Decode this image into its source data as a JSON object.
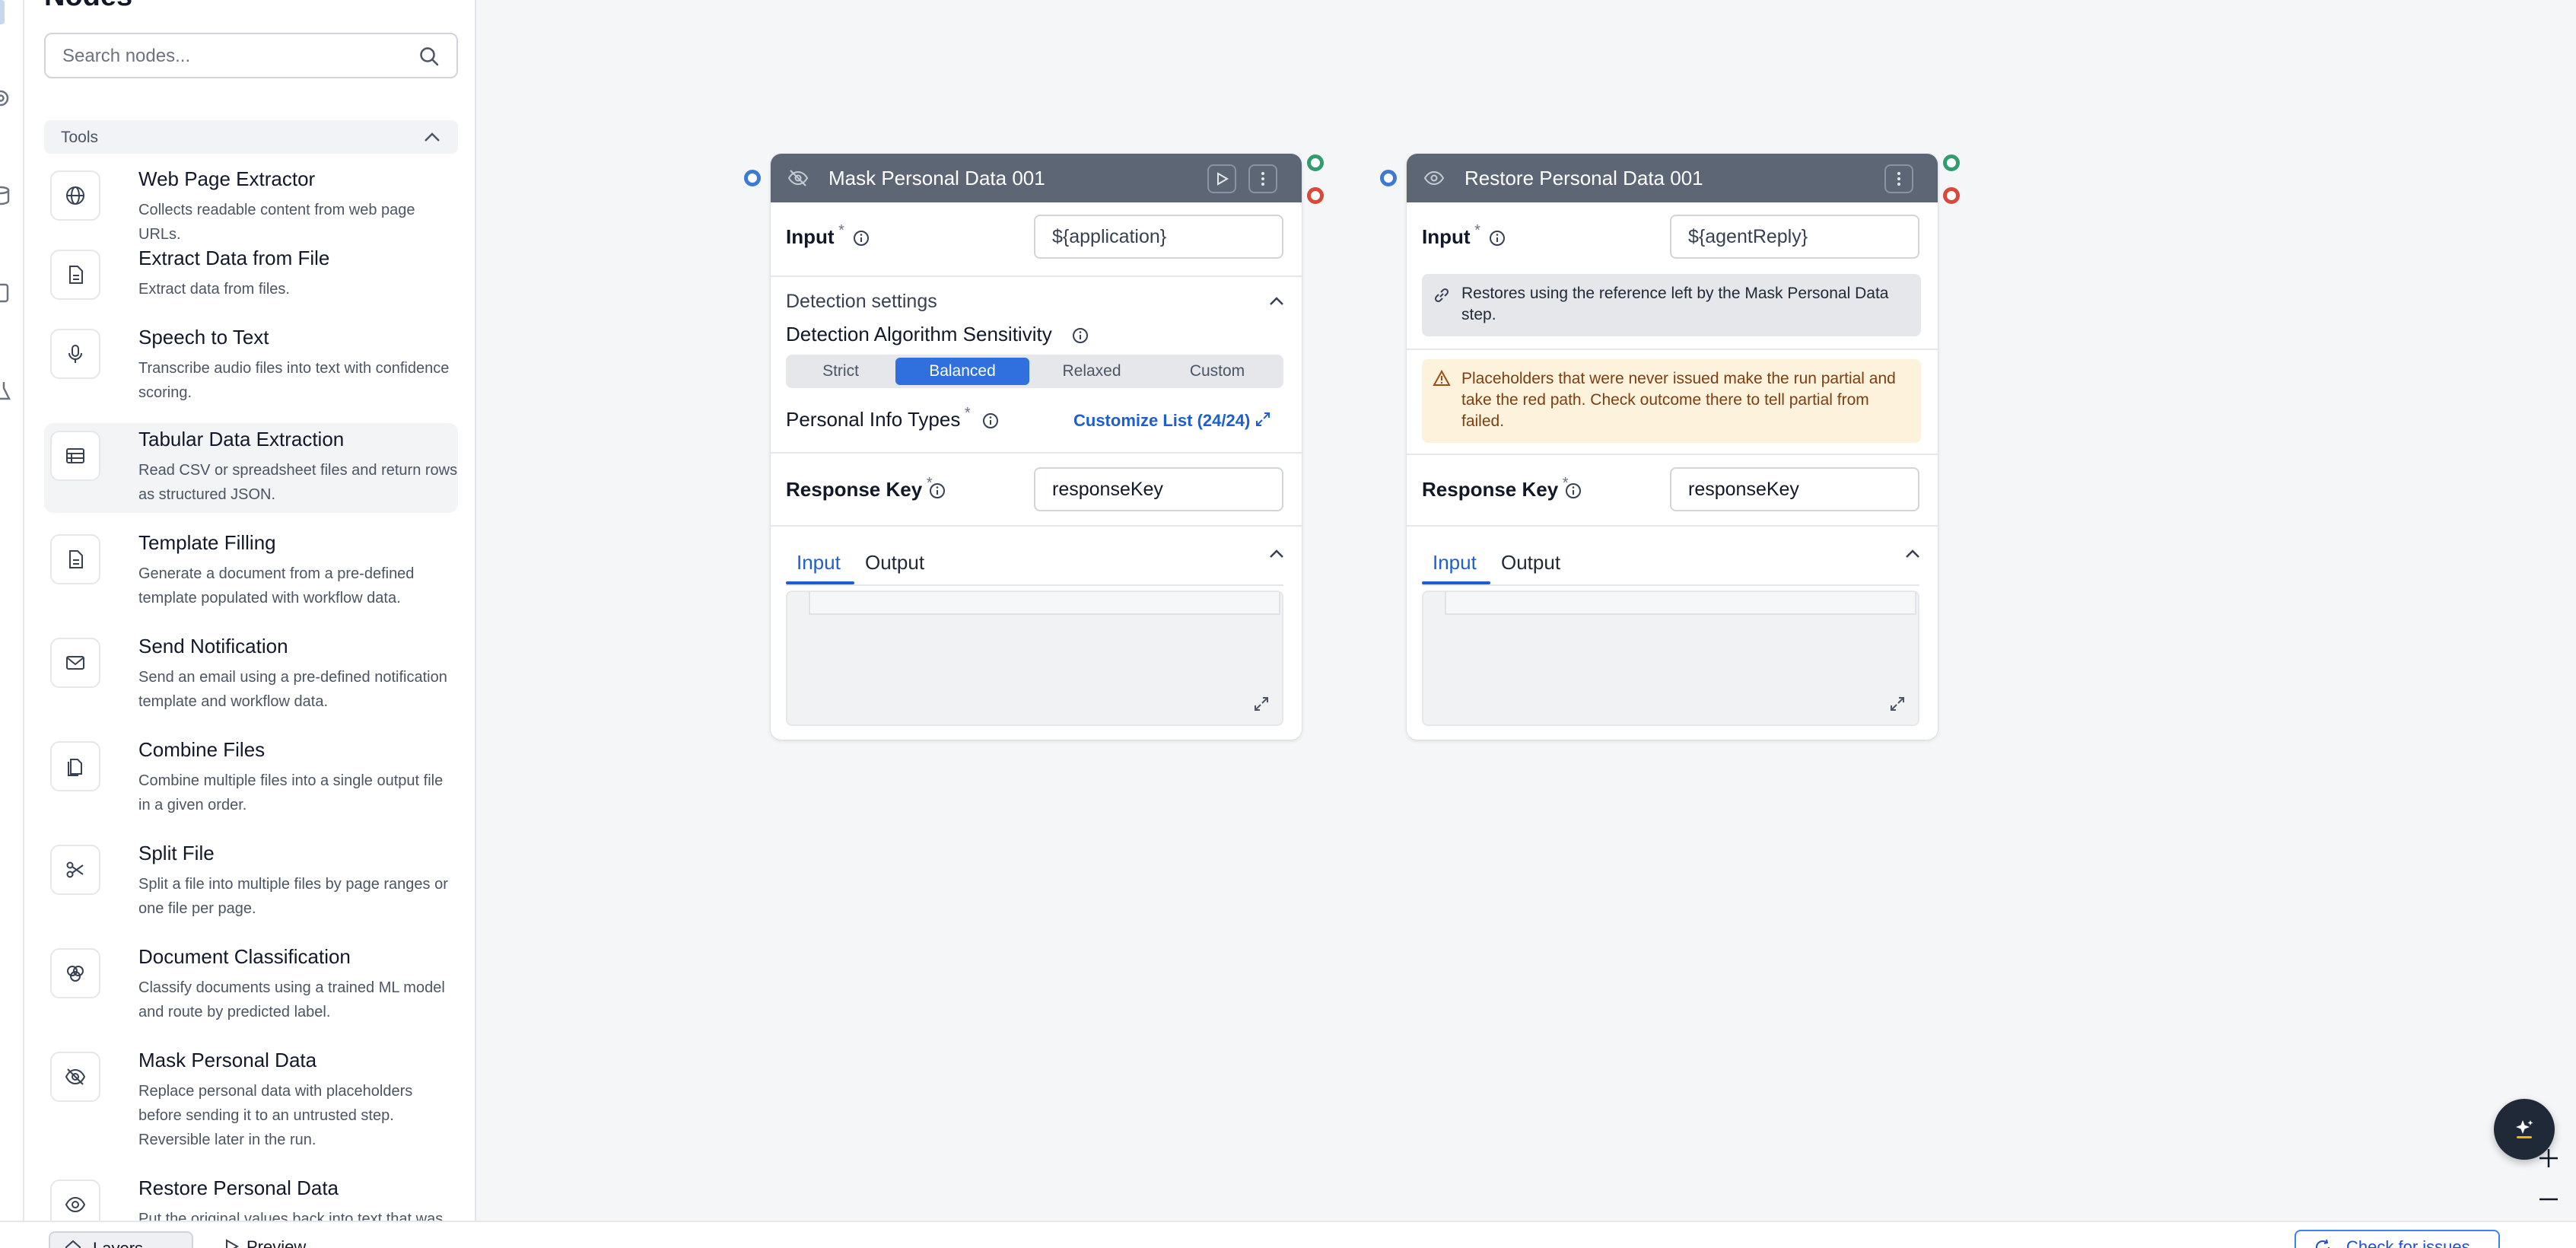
{
  "panel": {
    "title": "Nodes",
    "search_placeholder": "Search nodes...",
    "section_label": "Tools",
    "tools": [
      {
        "name": "Web Page Extractor",
        "desc": "Collects readable content from web page URLs.",
        "icon": "globe-icon"
      },
      {
        "name": "Extract Data from File",
        "desc": "Extract data from files.",
        "icon": "file-text-icon"
      },
      {
        "name": "Speech to Text",
        "desc": "Transcribe audio files into text with confidence scoring.",
        "icon": "microphone-icon"
      },
      {
        "name": "Tabular Data Extraction",
        "desc": "Read CSV or spreadsheet files and return rows as structured JSON.",
        "icon": "table-icon"
      },
      {
        "name": "Template Filling",
        "desc": "Generate a document from a pre-defined template populated with workflow data.",
        "icon": "file-text-icon"
      },
      {
        "name": "Send Notification",
        "desc": "Send an email using a pre-defined notification template and workflow data.",
        "icon": "mail-icon"
      },
      {
        "name": "Combine Files",
        "desc": "Combine multiple files into a single output file in a given order.",
        "icon": "files-icon"
      },
      {
        "name": "Split File",
        "desc": "Split a file into multiple files by page ranges or one file per page.",
        "icon": "scissors-icon"
      },
      {
        "name": "Document Classification",
        "desc": "Classify documents using a trained ML model and route by predicted label.",
        "icon": "brain-icon"
      },
      {
        "name": "Mask Personal Data",
        "desc": "Replace personal data with placeholders before sending it to an untrusted step. Reversible later in the run.",
        "icon": "eye-off-icon"
      },
      {
        "name": "Restore Personal Data",
        "desc": "Put the original values back into text that was",
        "icon": "eye-icon"
      }
    ]
  },
  "bottombar": {
    "tab1_label": "Layers",
    "tab2_label": "Preview",
    "check_label": "Check for issues"
  },
  "mask_node": {
    "title": "Mask Personal Data 001",
    "input_label": "Input",
    "input_value": "${application}",
    "detection_settings_label": "Detection settings",
    "sensitivity_label": "Detection Algorithm Sensitivity",
    "sensitivity_options": [
      "Strict",
      "Balanced",
      "Relaxed",
      "Custom"
    ],
    "sensitivity_selected": "Balanced",
    "info_types_label": "Personal Info Types",
    "customize_link": "Customize List (24/24)",
    "response_key_label": "Response Key",
    "response_key_value": "responseKey",
    "tab_input": "Input",
    "tab_output": "Output"
  },
  "restore_node": {
    "title": "Restore Personal Data 001",
    "input_label": "Input",
    "input_value": "${agentReply}",
    "notice": "Restores using the reference left by the Mask Personal Data step.",
    "warning": "Placeholders that were never issued make the run partial and take the red path. Check outcome there to tell partial from failed.",
    "response_key_label": "Response Key",
    "response_key_value": "responseKey",
    "tab_input": "Input",
    "tab_output": "Output"
  },
  "colors": {
    "header": "#5d6675",
    "accent": "#2f6fde",
    "link": "#1d5fd1",
    "success_port": "#2f9e6f",
    "error_port": "#d9483b",
    "input_port": "#3d7bd2",
    "warning_bg": "#fdf3dc"
  }
}
